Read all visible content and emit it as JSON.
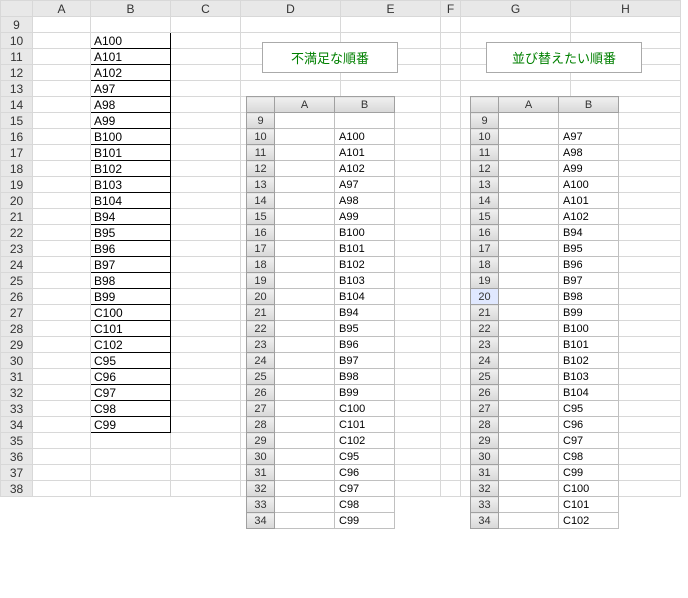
{
  "outer": {
    "colHeaders": [
      "A",
      "B",
      "C",
      "D",
      "E",
      "F",
      "G",
      "H"
    ],
    "startRow": 9,
    "endRow": 38,
    "bValues": {
      "10": "A100",
      "11": "A101",
      "12": "A102",
      "13": "A97",
      "14": "A98",
      "15": "A99",
      "16": "B100",
      "17": "B101",
      "18": "B102",
      "19": "B103",
      "20": "B104",
      "21": "B94",
      "22": "B95",
      "23": "B96",
      "24": "B97",
      "25": "B98",
      "26": "B99",
      "27": "C100",
      "28": "C101",
      "29": "C102",
      "30": "C95",
      "31": "C96",
      "32": "C97",
      "33": "C98",
      "34": "C99"
    }
  },
  "labels": {
    "left": "不満足な順番",
    "right": "並び替えたい順番"
  },
  "miniLeft": {
    "colHeaders": [
      "A",
      "B"
    ],
    "startRow": 9,
    "rows": [
      {
        "r": 9,
        "a": "",
        "b": ""
      },
      {
        "r": 10,
        "a": "",
        "b": "A100"
      },
      {
        "r": 11,
        "a": "",
        "b": "A101"
      },
      {
        "r": 12,
        "a": "",
        "b": "A102"
      },
      {
        "r": 13,
        "a": "",
        "b": "A97"
      },
      {
        "r": 14,
        "a": "",
        "b": "A98"
      },
      {
        "r": 15,
        "a": "",
        "b": "A99"
      },
      {
        "r": 16,
        "a": "",
        "b": "B100"
      },
      {
        "r": 17,
        "a": "",
        "b": "B101"
      },
      {
        "r": 18,
        "a": "",
        "b": "B102"
      },
      {
        "r": 19,
        "a": "",
        "b": "B103"
      },
      {
        "r": 20,
        "a": "",
        "b": "B104"
      },
      {
        "r": 21,
        "a": "",
        "b": "B94"
      },
      {
        "r": 22,
        "a": "",
        "b": "B95"
      },
      {
        "r": 23,
        "a": "",
        "b": "B96"
      },
      {
        "r": 24,
        "a": "",
        "b": "B97"
      },
      {
        "r": 25,
        "a": "",
        "b": "B98"
      },
      {
        "r": 26,
        "a": "",
        "b": "B99"
      },
      {
        "r": 27,
        "a": "",
        "b": "C100"
      },
      {
        "r": 28,
        "a": "",
        "b": "C101"
      },
      {
        "r": 29,
        "a": "",
        "b": "C102"
      },
      {
        "r": 30,
        "a": "",
        "b": "C95"
      },
      {
        "r": 31,
        "a": "",
        "b": "C96"
      },
      {
        "r": 32,
        "a": "",
        "b": "C97"
      },
      {
        "r": 33,
        "a": "",
        "b": "C98"
      },
      {
        "r": 34,
        "a": "",
        "b": "C99"
      }
    ]
  },
  "miniRight": {
    "colHeaders": [
      "A",
      "B"
    ],
    "startRow": 9,
    "selectedRow": 20,
    "rows": [
      {
        "r": 9,
        "a": "",
        "b": ""
      },
      {
        "r": 10,
        "a": "",
        "b": "A97"
      },
      {
        "r": 11,
        "a": "",
        "b": "A98"
      },
      {
        "r": 12,
        "a": "",
        "b": "A99"
      },
      {
        "r": 13,
        "a": "",
        "b": "A100"
      },
      {
        "r": 14,
        "a": "",
        "b": "A101"
      },
      {
        "r": 15,
        "a": "",
        "b": "A102"
      },
      {
        "r": 16,
        "a": "",
        "b": "B94"
      },
      {
        "r": 17,
        "a": "",
        "b": "B95"
      },
      {
        "r": 18,
        "a": "",
        "b": "B96"
      },
      {
        "r": 19,
        "a": "",
        "b": "B97"
      },
      {
        "r": 20,
        "a": "",
        "b": "B98"
      },
      {
        "r": 21,
        "a": "",
        "b": "B99"
      },
      {
        "r": 22,
        "a": "",
        "b": "B100"
      },
      {
        "r": 23,
        "a": "",
        "b": "B101"
      },
      {
        "r": 24,
        "a": "",
        "b": "B102"
      },
      {
        "r": 25,
        "a": "",
        "b": "B103"
      },
      {
        "r": 26,
        "a": "",
        "b": "B104"
      },
      {
        "r": 27,
        "a": "",
        "b": "C95"
      },
      {
        "r": 28,
        "a": "",
        "b": "C96"
      },
      {
        "r": 29,
        "a": "",
        "b": "C97"
      },
      {
        "r": 30,
        "a": "",
        "b": "C98"
      },
      {
        "r": 31,
        "a": "",
        "b": "C99"
      },
      {
        "r": 32,
        "a": "",
        "b": "C100"
      },
      {
        "r": 33,
        "a": "",
        "b": "C101"
      },
      {
        "r": 34,
        "a": "",
        "b": "C102"
      }
    ]
  }
}
